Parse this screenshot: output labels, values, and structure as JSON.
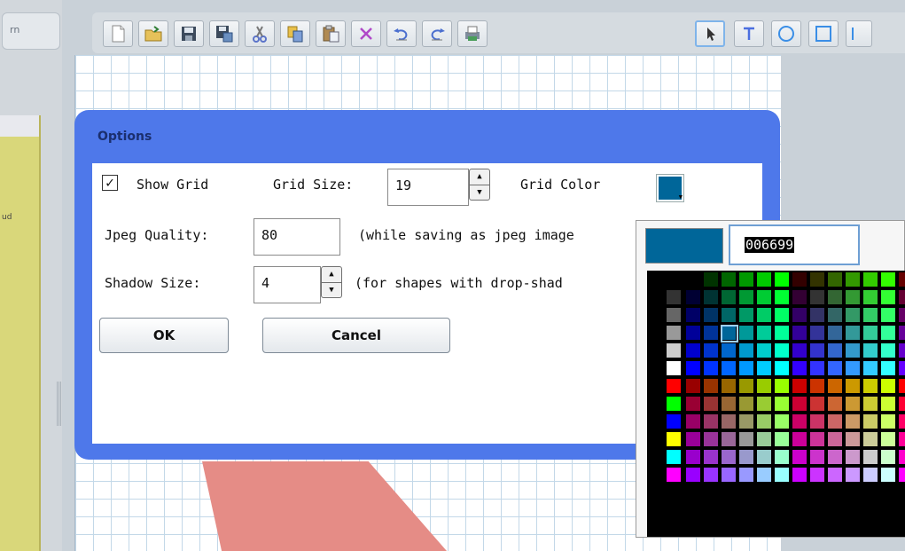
{
  "left_panel": {
    "search_fragment": "rn",
    "label_fragment": "ud"
  },
  "toolbar": {
    "buttons": [
      {
        "name": "new-document",
        "icon": "new-document-icon"
      },
      {
        "name": "open",
        "icon": "open-folder-icon"
      },
      {
        "name": "save",
        "icon": "save-icon"
      },
      {
        "name": "save-as",
        "icon": "save-as-icon"
      },
      {
        "name": "cut",
        "icon": "cut-icon"
      },
      {
        "name": "copy",
        "icon": "copy-icon"
      },
      {
        "name": "paste",
        "icon": "paste-icon"
      },
      {
        "name": "delete",
        "icon": "delete-icon"
      },
      {
        "name": "undo",
        "icon": "undo-icon"
      },
      {
        "name": "redo",
        "icon": "redo-icon"
      },
      {
        "name": "print",
        "icon": "print-icon"
      },
      {
        "name": "select-tool",
        "icon": "pointer-icon",
        "selected": true
      },
      {
        "name": "text-tool",
        "icon": "text-icon"
      },
      {
        "name": "ellipse-tool",
        "icon": "ellipse-icon"
      },
      {
        "name": "rectangle-tool",
        "icon": "rectangle-icon"
      }
    ]
  },
  "dialog": {
    "title": "Options",
    "show_grid_label": "Show Grid",
    "show_grid_checked": true,
    "grid_size_label": "Grid Size:",
    "grid_size_value": "19",
    "grid_color_label": "Grid Color",
    "grid_color": "#006699",
    "jpeg_quality_label": "Jpeg Quality:",
    "jpeg_quality_value": "80",
    "jpeg_note": "(while saving as jpeg image",
    "shadow_size_label": "Shadow Size:",
    "shadow_size_value": "4",
    "shadow_note": "(for shapes with drop-shad",
    "ok_label": "OK",
    "cancel_label": "Cancel"
  },
  "color_picker": {
    "hex_value": "006699",
    "preview_color": "#006699",
    "selected_color": "#006699"
  },
  "colors": {
    "dialog_frame": "#4e78ea",
    "canvas_shape": "#e58c86",
    "grid_lines": "#c3d8e8"
  }
}
